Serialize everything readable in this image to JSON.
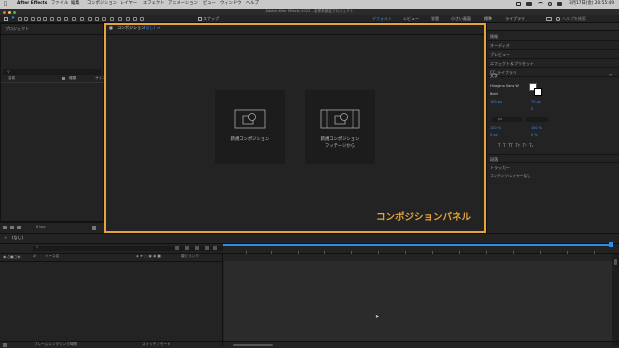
{
  "menubar": {
    "apple": "",
    "app": "After Effects",
    "items": [
      "ファイル",
      "編集",
      "コンポジション",
      "レイヤー",
      "エフェクト",
      "アニメーション",
      "ビュー",
      "ウィンドウ",
      "ヘルプ"
    ],
    "clock": "3月17日(金) 20:55:49"
  },
  "titlebar": {
    "title": "Adobe After Effects 2023 - 名称未設定プロジェクト"
  },
  "toolbar": {
    "snap_label": "スナップ",
    "workspaces": [
      "デフォルト",
      "レビュー",
      "学習",
      "小さい画面",
      "標準",
      "ライブラリ"
    ],
    "search_placeholder": "ヘルプを検索"
  },
  "project_panel": {
    "title": "プロジェクト",
    "col_name": "名前",
    "col_type": "種類",
    "col_size": "サイズ",
    "bpc": "8 bpc"
  },
  "comp_panel": {
    "tab": "コンポジション",
    "tab_suffix": "(なし)",
    "card1_label": "新規コンポジション",
    "card2_line1": "新規コンポジション",
    "card2_line2": "フッテージから",
    "annotation": "コンポジションパネル"
  },
  "right_panel": {
    "info": "情報",
    "audio": "オーディオ",
    "preview": "プレビュー",
    "effects": "エフェクト＆プリセット",
    "cc_library": "CC ライブラリ",
    "character": "文字",
    "font_name": "Hiragino Sans W",
    "font_style": "Bold",
    "font_size": "100 px",
    "leading": "70 px",
    "tracking": "0",
    "unit": "px",
    "vscale": "100 %",
    "hscale": "100 %",
    "baseline": "0 px",
    "tsume": "0 %",
    "paragraph": "段落",
    "tracker": "トラッカー",
    "content_label": "コンテンツ:レイヤーなし"
  },
  "timeline": {
    "tab": "(なし)",
    "col_source": "ソース名",
    "col_switches": "親とリンク",
    "footer_left": "フレームレンダリング時間",
    "footer_mid": "スイッチ / モード"
  },
  "colors": {
    "accent": "#e8a33b",
    "playhead": "#2d8ceb"
  }
}
